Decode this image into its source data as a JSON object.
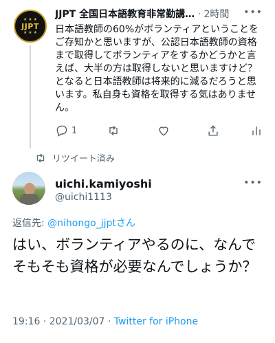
{
  "parent": {
    "avatar_text": "JJPT",
    "name": "JJPT 全国日本語教育非常勤講…",
    "separator": "·",
    "time": "2時間",
    "text": "日本語教師の60%がボランティアということをご存知かと思いますが、公認日本語教師の資格まで取得してボランティアをするかどうかと言えば、大半の方は取得しないと思いますけど？となると日本語教師は将来的に減るだろうと思います。私自身も資格を取得する気はありません。",
    "reply_count": "1"
  },
  "retweet_label": "リツイート済み",
  "tweet": {
    "name": "uichi.kamiyoshi",
    "handle": "@uichi1113",
    "reply_prefix": "返信先: ",
    "reply_target": "@nihongo_jjptさん",
    "text": "はい、ボランティアやるのに、なんでそもそも資格が必要なんでしょうか？",
    "time": "19:16",
    "date": "2021/03/07",
    "separator": "·",
    "source": "Twitter for iPhone"
  },
  "colors": {
    "link": "#1d9bf0",
    "secondary": "#536471",
    "logo_gold": "#e2bf3a"
  }
}
